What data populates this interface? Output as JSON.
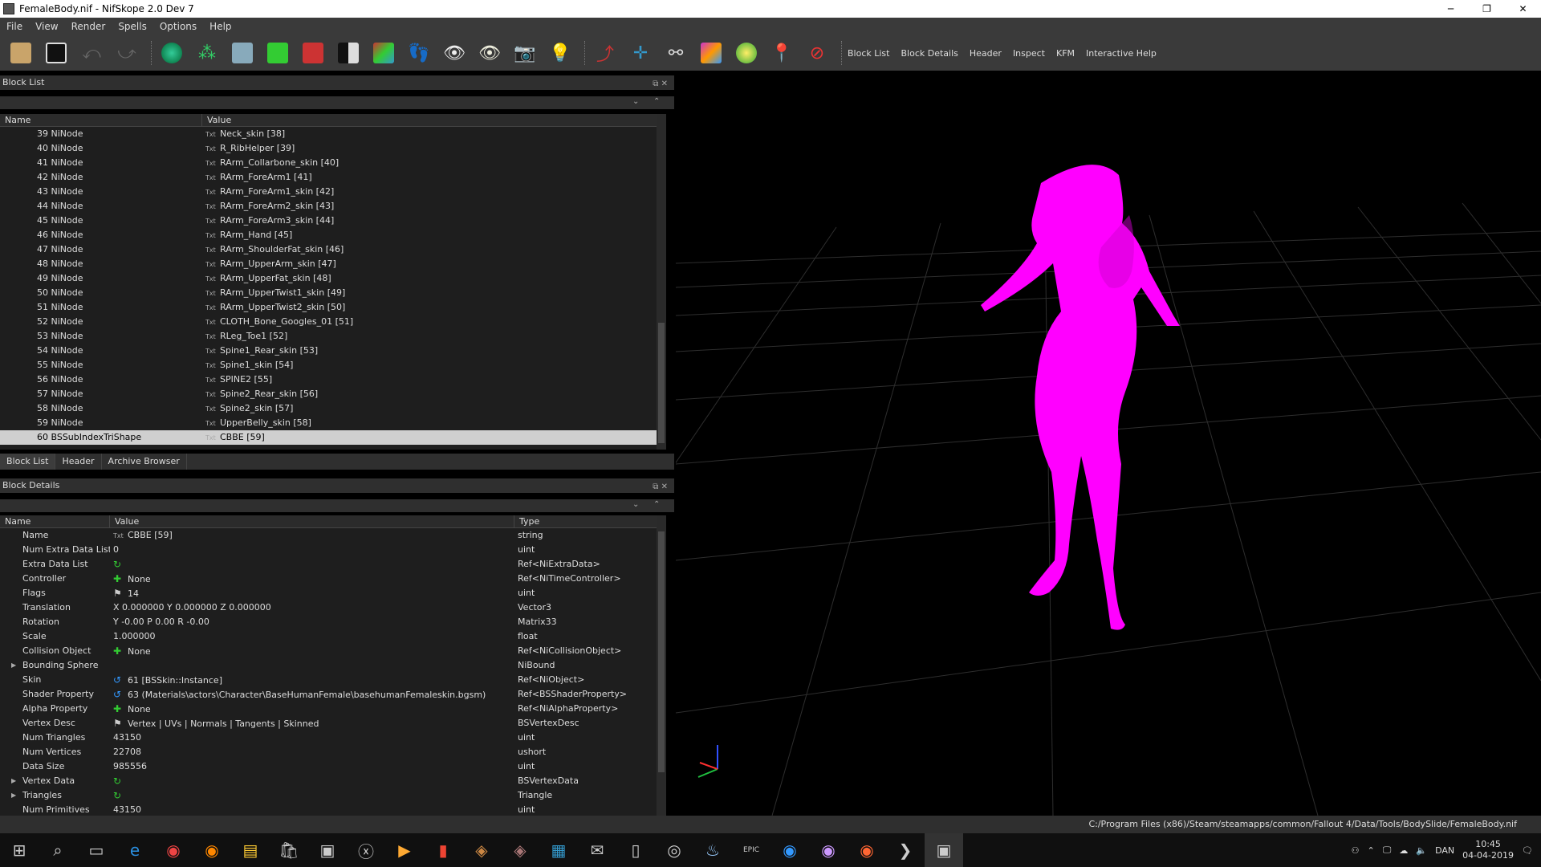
{
  "window": {
    "title": "FemaleBody.nif - NifSkope 2.0 Dev 7",
    "minimize": "─",
    "restore": "❐",
    "close": "✕"
  },
  "menu": [
    "File",
    "View",
    "Render",
    "Spells",
    "Options",
    "Help"
  ],
  "toolbar": {
    "links": [
      "Block List",
      "Block Details",
      "Header",
      "Inspect",
      "KFM",
      "Interactive Help"
    ]
  },
  "block_list": {
    "title": "Block List",
    "columns": [
      "Name",
      "Value"
    ],
    "rows": [
      {
        "name": "39 NiNode",
        "value": "Neck_skin [38]"
      },
      {
        "name": "40 NiNode",
        "value": "R_RibHelper [39]"
      },
      {
        "name": "41 NiNode",
        "value": "RArm_Collarbone_skin [40]"
      },
      {
        "name": "42 NiNode",
        "value": "RArm_ForeArm1 [41]"
      },
      {
        "name": "43 NiNode",
        "value": "RArm_ForeArm1_skin [42]"
      },
      {
        "name": "44 NiNode",
        "value": "RArm_ForeArm2_skin [43]"
      },
      {
        "name": "45 NiNode",
        "value": "RArm_ForeArm3_skin [44]"
      },
      {
        "name": "46 NiNode",
        "value": "RArm_Hand [45]"
      },
      {
        "name": "47 NiNode",
        "value": "RArm_ShoulderFat_skin [46]"
      },
      {
        "name": "48 NiNode",
        "value": "RArm_UpperArm_skin [47]"
      },
      {
        "name": "49 NiNode",
        "value": "RArm_UpperFat_skin [48]"
      },
      {
        "name": "50 NiNode",
        "value": "RArm_UpperTwist1_skin [49]"
      },
      {
        "name": "51 NiNode",
        "value": "RArm_UpperTwist2_skin [50]"
      },
      {
        "name": "52 NiNode",
        "value": "CLOTH_Bone_Googles_01 [51]"
      },
      {
        "name": "53 NiNode",
        "value": "RLeg_Toe1 [52]"
      },
      {
        "name": "54 NiNode",
        "value": "Spine1_Rear_skin [53]"
      },
      {
        "name": "55 NiNode",
        "value": "Spine1_skin [54]"
      },
      {
        "name": "56 NiNode",
        "value": "SPINE2 [55]"
      },
      {
        "name": "57 NiNode",
        "value": "Spine2_Rear_skin [56]"
      },
      {
        "name": "58 NiNode",
        "value": "Spine2_skin [57]"
      },
      {
        "name": "59 NiNode",
        "value": "UpperBelly_skin [58]"
      },
      {
        "name": "60 BSSubIndexTriShape",
        "value": "CBBE [59]"
      }
    ],
    "selected_index": 21
  },
  "tabs": [
    "Block List",
    "Header",
    "Archive Browser"
  ],
  "block_details": {
    "title": "Block Details",
    "columns": [
      "Name",
      "Value",
      "Type"
    ],
    "rows": [
      {
        "name": "Name",
        "value": "CBBE [59]",
        "type": "string",
        "icon": "txt"
      },
      {
        "name": "Num Extra Data List",
        "value": "0",
        "type": "uint",
        "icon": ""
      },
      {
        "name": "Extra Data List",
        "value": "",
        "type": "Ref<NiExtraData>",
        "icon": "refresh"
      },
      {
        "name": "Controller",
        "value": "None",
        "type": "Ref<NiTimeController>",
        "icon": "plus"
      },
      {
        "name": "Flags",
        "value": "14",
        "type": "uint",
        "icon": "flag"
      },
      {
        "name": "Translation",
        "value": "X 0.000000 Y 0.000000 Z 0.000000",
        "type": "Vector3",
        "icon": ""
      },
      {
        "name": "Rotation",
        "value": "Y -0.00 P 0.00 R -0.00",
        "type": "Matrix33",
        "icon": ""
      },
      {
        "name": "Scale",
        "value": "1.000000",
        "type": "float",
        "icon": ""
      },
      {
        "name": "Collision Object",
        "value": "None",
        "type": "Ref<NiCollisionObject>",
        "icon": "plus"
      },
      {
        "name": "Bounding Sphere",
        "value": "",
        "type": "NiBound",
        "icon": "",
        "expand": "▶"
      },
      {
        "name": "Skin",
        "value": "61 [BSSkin::Instance]",
        "type": "Ref<NiObject>",
        "icon": "link"
      },
      {
        "name": "Shader Property",
        "value": "63 (Materials\\actors\\Character\\BaseHumanFemale\\basehumanFemaleskin.bgsm)",
        "type": "Ref<BSShaderProperty>",
        "icon": "link"
      },
      {
        "name": "Alpha Property",
        "value": "None",
        "type": "Ref<NiAlphaProperty>",
        "icon": "plus"
      },
      {
        "name": "Vertex Desc",
        "value": "Vertex | UVs | Normals | Tangents | Skinned",
        "type": "BSVertexDesc",
        "icon": "flag"
      },
      {
        "name": "Num Triangles",
        "value": "43150",
        "type": "uint",
        "icon": ""
      },
      {
        "name": "Num Vertices",
        "value": "22708",
        "type": "ushort",
        "icon": ""
      },
      {
        "name": "Data Size",
        "value": "985556",
        "type": "uint",
        "icon": ""
      },
      {
        "name": "Vertex Data",
        "value": "",
        "type": "BSVertexData",
        "icon": "refresh",
        "expand": "▶"
      },
      {
        "name": "Triangles",
        "value": "",
        "type": "Triangle",
        "icon": "refresh",
        "expand": "▶"
      },
      {
        "name": "Num Primitives",
        "value": "43150",
        "type": "uint",
        "icon": ""
      }
    ]
  },
  "status_path": "C:/Program Files (x86)/Steam/steamapps/common/Fallout 4/Data/Tools/BodySlide/FemaleBody.nif",
  "taskbar": {
    "lang": "DAN",
    "time": "10:45",
    "date": "04-04-2019"
  },
  "colors": {
    "body": "#ff00ff",
    "panel_bg": "#1e1e1e",
    "toolbar_bg": "#3a3a3a",
    "selection": "#cfcfcf"
  }
}
